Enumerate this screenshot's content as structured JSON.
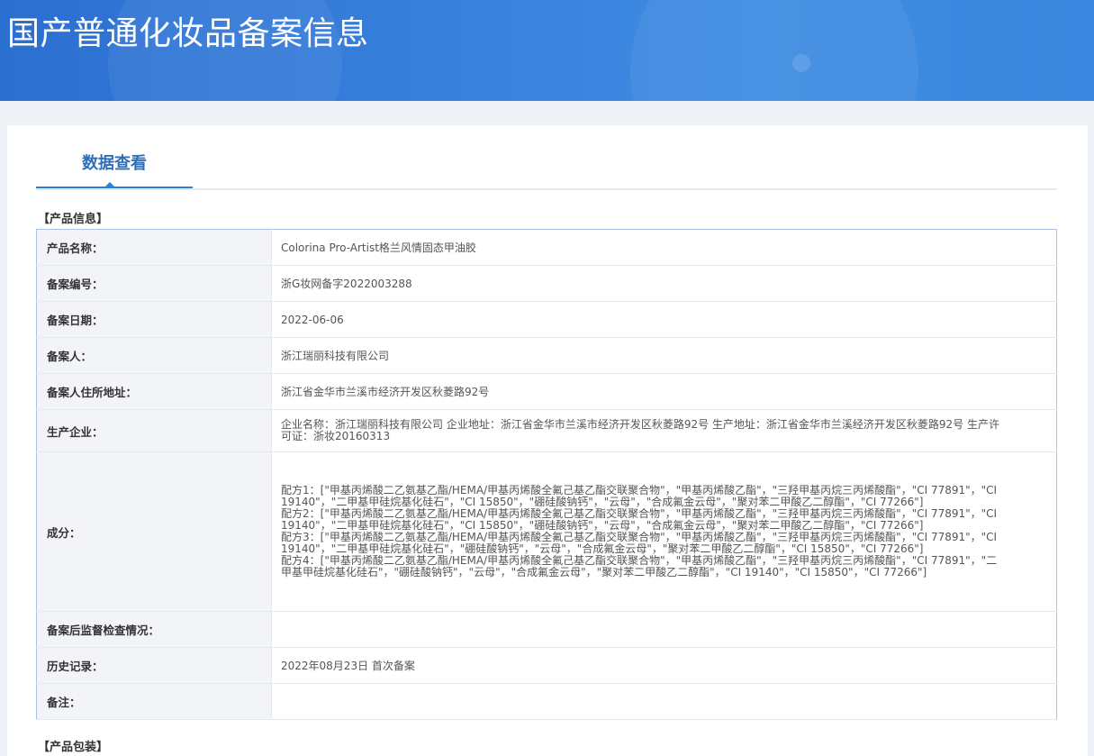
{
  "header": {
    "title": "国产普通化妆品备案信息"
  },
  "tabs": [
    {
      "label": "数据查看",
      "active": true
    }
  ],
  "product_section": {
    "title": "【产品信息】",
    "rows": {
      "name": {
        "label": "产品名称：",
        "value": "Colorina Pro-Artist格兰风情固态甲油胶"
      },
      "record_no": {
        "label": "备案编号：",
        "value": "浙G妆网备字2022003288"
      },
      "record_date": {
        "label": "备案日期：",
        "value": "2022-06-06"
      },
      "registrant": {
        "label": "备案人：",
        "value": "浙江瑞丽科技有限公司"
      },
      "registrant_address": {
        "label": "备案人住所地址：",
        "value": "浙江省金华市兰溪市经济开发区秋菱路92号"
      },
      "manufacturer": {
        "label": "生产企业：",
        "value": "企业名称：浙江瑞丽科技有限公司 企业地址：浙江省金华市兰溪市经济开发区秋菱路92号 生产地址：浙江省金华市兰溪经济开发区秋菱路92号 生产许可证：浙妆20160313"
      },
      "ingredients": {
        "label": "成分：",
        "formulas": [
          "配方1：[\"甲基丙烯酸二乙氨基乙酯/HEMA/甲基丙烯酸全氟己基乙酯交联聚合物\"，\"甲基丙烯酸乙酯\"，\"三羟甲基丙烷三丙烯酸酯\"，\"CI 77891\"，\"CI 19140\"，\"二甲基甲硅烷基化硅石\"，\"CI 15850\"，\"硼硅酸钠钙\"，\"云母\"，\"合成氟金云母\"，\"聚对苯二甲酸乙二醇酯\"，\"CI 77266\"]",
          "配方2：[\"甲基丙烯酸二乙氨基乙酯/HEMA/甲基丙烯酸全氟己基乙酯交联聚合物\"，\"甲基丙烯酸乙酯\"，\"三羟甲基丙烷三丙烯酸酯\"，\"CI 77891\"，\"CI 19140\"，\"二甲基甲硅烷基化硅石\"，\"CI 15850\"，\"硼硅酸钠钙\"，\"云母\"，\"合成氟金云母\"，\"聚对苯二甲酸乙二醇酯\"，\"CI 77266\"]",
          "配方3：[\"甲基丙烯酸二乙氨基乙酯/HEMA/甲基丙烯酸全氟己基乙酯交联聚合物\"，\"甲基丙烯酸乙酯\"，\"三羟甲基丙烷三丙烯酸酯\"，\"CI 77891\"，\"CI 19140\"，\"二甲基甲硅烷基化硅石\"，\"硼硅酸钠钙\"，\"云母\"，\"合成氟金云母\"，\"聚对苯二甲酸乙二醇酯\"，\"CI 15850\"，\"CI 77266\"]",
          "配方4：[\"甲基丙烯酸二乙氨基乙酯/HEMA/甲基丙烯酸全氟己基乙酯交联聚合物\"，\"甲基丙烯酸乙酯\"，\"三羟甲基丙烷三丙烯酸酯\"，\"CI 77891\"，\"二甲基甲硅烷基化硅石\"，\"硼硅酸钠钙\"，\"云母\"，\"合成氟金云母\"，\"聚对苯二甲酸乙二醇酯\"，\"CI 19140\"，\"CI 15850\"，\"CI 77266\"]"
        ]
      },
      "inspection": {
        "label": "备案后监督检查情况：",
        "value": ""
      },
      "history": {
        "label": "历史记录：",
        "value": "2022年08月23日 首次备案"
      },
      "remarks": {
        "label": "备注：",
        "value": ""
      }
    }
  },
  "next_section": {
    "title": "【产品包装】"
  },
  "colors": {
    "banner": "#3a82de",
    "tab_active": "#2f6fb7",
    "table_border": "#a8c4e2",
    "label_bg": "#f2f4f7"
  }
}
